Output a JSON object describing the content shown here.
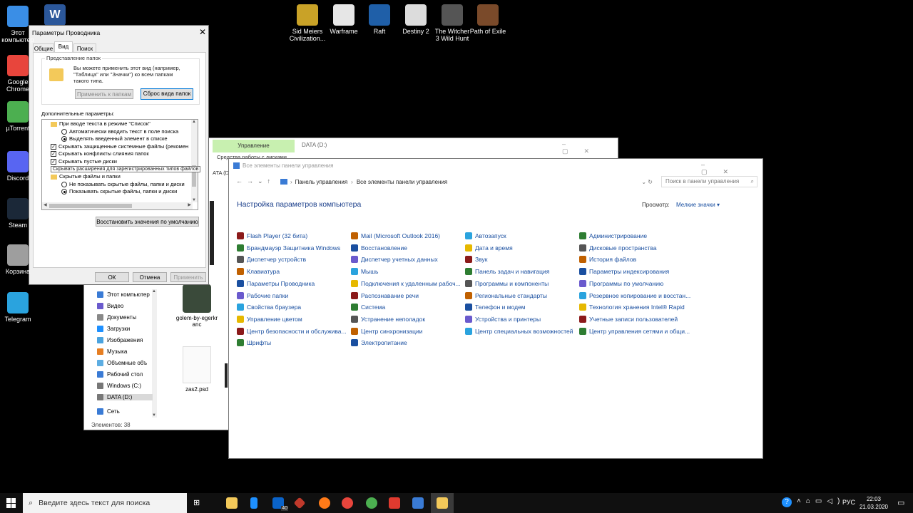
{
  "desktop": {
    "left_icons": [
      {
        "label": "Этот компьютер",
        "color": "#3a8ee6"
      },
      {
        "label": "Google Chrome",
        "color": "#e8453c"
      },
      {
        "label": "µTorrent",
        "color": "#4caf50"
      },
      {
        "label": "Discord",
        "color": "#5865f2"
      },
      {
        "label": "Steam",
        "color": "#1b2838"
      },
      {
        "label": "Корзина",
        "color": "#9e9e9e"
      },
      {
        "label": "Telegram",
        "color": "#2aa3de"
      }
    ],
    "word_icon_color": "#2b579a",
    "top_icons": [
      {
        "label": "Sid Meiers Civilization...",
        "color": "#c9a227"
      },
      {
        "label": "Warframe",
        "color": "#e6e6e6"
      },
      {
        "label": "Raft",
        "color": "#1f5fa8"
      },
      {
        "label": "Destiny 2",
        "color": "#dcdcdc"
      },
      {
        "label": "The Witcher 3 Wild Hunt",
        "color": "#555555"
      },
      {
        "label": "Path of Exile",
        "color": "#7a4a2a"
      }
    ]
  },
  "explorer": {
    "ribbon_tab": "Управление",
    "title": "DATA (D:)",
    "subtab": "Средства работы с дисками",
    "address_fragment": "ATA (D:)",
    "nav": [
      "Этот компьютер",
      "Видео",
      "Документы",
      "Загрузки",
      "Изображения",
      "Музыка",
      "Объемные объ",
      "Рабочий стол",
      "Windows (C:)",
      "DATA (D:)",
      "Сеть"
    ],
    "files": [
      {
        "name": "golem-by-egerkr anc"
      },
      {
        "name": "zas2.psd"
      }
    ],
    "status": "Элементов: 38"
  },
  "control_panel": {
    "window_title": "Все элементы панели управления",
    "breadcrumb": [
      "Панель управления",
      "Все элементы панели управления"
    ],
    "search_placeholder": "Поиск в панели управления",
    "heading": "Настройка параметров компьютера",
    "view_label": "Просмотр:",
    "view_value": "Мелкие значки",
    "columns": [
      [
        "Flash Player (32 бита)",
        "Брандмауэр Защитника Windows",
        "Диспетчер устройств",
        "Клавиатура",
        "Параметры Проводника",
        "Рабочие папки",
        "Свойства браузера",
        "Управление цветом",
        "Центр безопасности и обслужива...",
        "Шрифты"
      ],
      [
        "Mail (Microsoft Outlook 2016)",
        "Восстановление",
        "Диспетчер учетных данных",
        "Мышь",
        "Подключения к удаленным рабоч...",
        "Распознавание речи",
        "Система",
        "Устранение неполадок",
        "Центр синхронизации",
        "Электропитание"
      ],
      [
        "Автозапуск",
        "Дата и время",
        "Звук",
        "Панель задач и навигация",
        "Программы и компоненты",
        "Региональные стандарты",
        "Телефон и модем",
        "Устройства и принтеры",
        "Центр специальных возможностей"
      ],
      [
        "Администрирование",
        "Дисковые пространства",
        "История файлов",
        "Параметры индексирования",
        "Программы по умолчанию",
        "Резервное копирование и восстан...",
        "Технология хранения Intel® Rapid",
        "Учетные записи пользователей",
        "Центр управления сетями и общи..."
      ]
    ],
    "accent": "#1a4fa0"
  },
  "dialog": {
    "title": "Параметры Проводника",
    "tabs": [
      "Общие",
      "Вид",
      "Поиск"
    ],
    "group_title": "Представление папок",
    "group_text": "Вы можете применить этот вид (например, \"Таблица\" или \"Значки\") ко всем папкам такого типа.",
    "apply_folders": "Применить к папкам",
    "reset_folders": "Сброс вида папок",
    "advanced_label": "Дополнительные параметры:",
    "tree": [
      {
        "type": "folder",
        "text": "При вводе текста в режиме \"Список\""
      },
      {
        "type": "radio",
        "on": false,
        "text": "Автоматически вводить текст в поле поиска"
      },
      {
        "type": "radio",
        "on": true,
        "text": "Выделять введенный элемент в списке"
      },
      {
        "type": "check",
        "on": true,
        "text": "Скрывать защищенные системные файлы (рекомен"
      },
      {
        "type": "check",
        "on": true,
        "text": "Скрывать конфликты слияния папок"
      },
      {
        "type": "check",
        "on": true,
        "text": "Скрывать пустые диски"
      },
      {
        "type": "check",
        "on": true,
        "text": "Скрывать расширения для зарегистрированных типов файлов"
      },
      {
        "type": "folder",
        "text": "Скрытые файлы и папки"
      },
      {
        "type": "radio",
        "on": false,
        "text": "Не показывать скрытые файлы, папки и диски"
      },
      {
        "type": "radio",
        "on": true,
        "text": "Показывать скрытые файлы, папки и диски"
      }
    ],
    "restore_defaults": "Восстановить значения по умолчанию",
    "ok": "ОК",
    "cancel": "Отмена",
    "apply": "Применить"
  },
  "taskbar": {
    "search_placeholder": "Введите здесь текст для поиска",
    "mail_badge": "40",
    "lang": "РУС",
    "time": "22:03",
    "date": "21.03.2020"
  }
}
